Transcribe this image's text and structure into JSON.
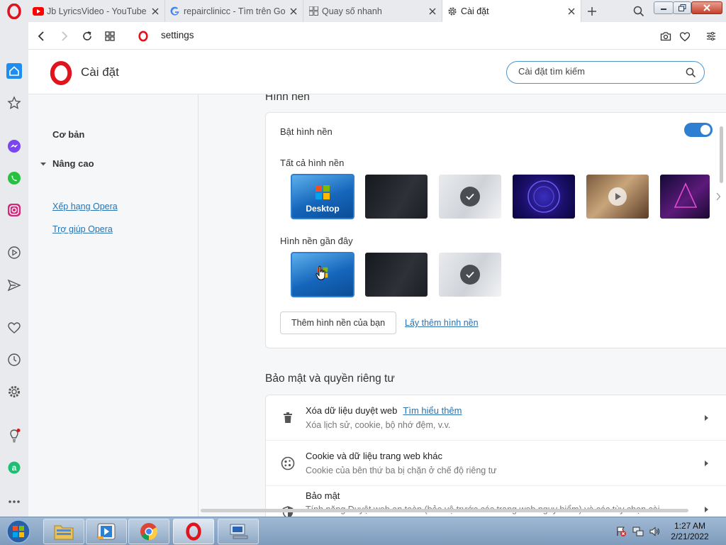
{
  "tabs": [
    {
      "title": "Jb LyricsVideo - YouTube",
      "favicon": "youtube-icon",
      "active": false
    },
    {
      "title": "repairclinicc - Tìm trên Google",
      "favicon": "google-icon",
      "active": false
    },
    {
      "title": "Quay số nhanh",
      "favicon": "speed-dial-icon",
      "active": false
    },
    {
      "title": "Cài đặt",
      "favicon": "gear-icon",
      "active": true
    }
  ],
  "address_bar": {
    "url": "settings"
  },
  "header": {
    "title": "Cài đặt",
    "search_placeholder": "Cài đặt tìm kiếm"
  },
  "left_nav": {
    "basic": "Cơ bản",
    "advanced": "Nâng cao",
    "links": [
      "Xếp hạng Opera",
      "Trợ giúp Opera"
    ]
  },
  "wallpaper": {
    "heading": "Hình nền",
    "enable_label": "Bật hình nền",
    "enabled": true,
    "all_label": "Tất cả hình nền",
    "recent_label": "Hình nền gần đây",
    "desktop_label": "Desktop",
    "add_button": "Thêm hình nền của bạn",
    "more_link": "Lấy thêm hình nền"
  },
  "privacy": {
    "heading": "Bảo mật và quyền riêng tư",
    "rows": [
      {
        "title": "Xóa dữ liệu duyệt web",
        "link": "Tìm hiểu thêm",
        "sub": "Xóa lịch sử, cookie, bộ nhớ đệm, v.v.",
        "icon": "trash-icon"
      },
      {
        "title": "Cookie và dữ liệu trang web khác",
        "link": "",
        "sub": "Cookie của bên thứ ba bị chặn ở chế độ riêng tư",
        "icon": "cookie-icon"
      },
      {
        "title": "Bảo mật",
        "link": "",
        "sub": "Tính năng Duyệt web an toàn (bảo vệ trước các trang web nguy hiểm) và các tùy chọn cài",
        "icon": "shield-icon"
      }
    ]
  },
  "taskbar": {
    "time": "1:27 AM",
    "date": "2/21/2022"
  },
  "colors": {
    "accent": "#2e7fd2",
    "opera_red": "#e0141d",
    "link": "#2a72b0"
  }
}
